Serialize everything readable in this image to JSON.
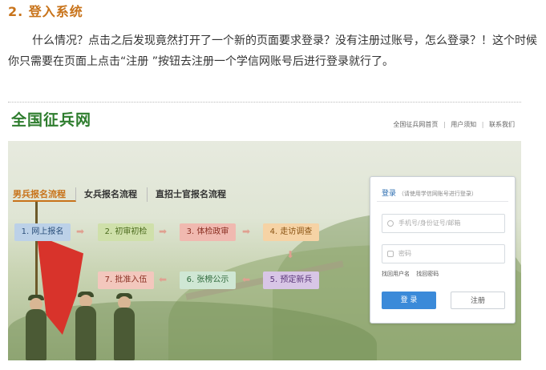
{
  "article": {
    "heading": "2.  登入系统",
    "paragraph": "什么情况？点击之后发现竟然打开了一个新的页面要求登录？没有注册过账号，怎么登录？！这个时候你只需要在页面上点击“注册 ”按钮去注册一个学信网账号后进行登录就行了。"
  },
  "site": {
    "logo": "全国征兵网",
    "toplinks": [
      "全国征兵网首页",
      "用户须知",
      "联系我们"
    ],
    "separator": "|",
    "tabs": [
      "男兵报名流程",
      "女兵报名流程",
      "直招士官报名流程"
    ],
    "steps": [
      "1. 网上报名",
      "2. 初审初检",
      "3. 体检政审",
      "4. 走访调查",
      "5. 预定新兵",
      "6. 张榜公示",
      "7. 批准入伍"
    ],
    "arrow_right": "➡",
    "arrow_left": "⬅",
    "arrow_down": "⬇",
    "login": {
      "title": "登录",
      "subtitle": "（请使用学信网账号进行登录）",
      "username_placeholder": "手机号/身份证号/邮箱",
      "password_placeholder": "密码",
      "forgot_username": "找回用户名",
      "forgot_password": "找回密码",
      "login_button": "登 录",
      "register_button": "注册"
    }
  },
  "colors": {
    "heading": "#c8731a",
    "logo": "#2e7d2e",
    "login_button": "#3b8ad9"
  }
}
